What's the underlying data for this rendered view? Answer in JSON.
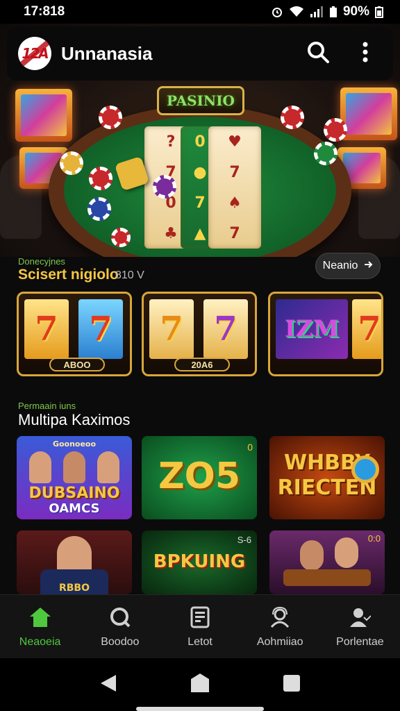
{
  "status_bar": {
    "time": "17:818",
    "battery": "90%"
  },
  "app_bar": {
    "logo_text": "12A",
    "title": "Unnanasia",
    "icons": {
      "search": "search-icon",
      "more": "more-vertical-icon"
    }
  },
  "hero": {
    "sign": "PASINIO",
    "reel_symbols": [
      [
        "?",
        "7",
        "0",
        "♣"
      ],
      [
        "0",
        "●",
        "7",
        "▲"
      ],
      [
        "♥",
        "7",
        "♠",
        "7"
      ]
    ]
  },
  "section_slots": {
    "subtitle": "Donecyjnes",
    "title": "Scisert nigiolo",
    "count": "810 V",
    "next_label": "Neanio",
    "cards": [
      {
        "symbols": [
          "7",
          "7"
        ],
        "badge": "ABOO"
      },
      {
        "symbols": [
          "7",
          "7"
        ],
        "badge": "20A6"
      },
      {
        "symbols": [
          "IZM",
          "7"
        ],
        "badge": ""
      }
    ]
  },
  "section_games": {
    "subtitle": "Permaain iuns",
    "title": "Multipa Kaximos",
    "cards": [
      {
        "line1": "DUBSAINO",
        "line2": "OAMCS",
        "top": "Goonoeoo"
      },
      {
        "line1": "ZO5",
        "line2": "",
        "top": "0"
      },
      {
        "line1": "WHBBY",
        "line2": "RIECTEN",
        "top": ""
      },
      {
        "line1": "RBBO",
        "line2": "",
        "top": ""
      },
      {
        "line1": "BPKUING",
        "line2": "",
        "top": "S-6"
      },
      {
        "line1": "",
        "line2": "",
        "top": "0:0"
      }
    ]
  },
  "bottom_nav": [
    {
      "label": "Neaoeia",
      "icon": "home-icon",
      "active": true
    },
    {
      "label": "Boodoo",
      "icon": "search-circle-icon",
      "active": false
    },
    {
      "label": "Letot",
      "icon": "receipt-icon",
      "active": false
    },
    {
      "label": "Aohmiiao",
      "icon": "support-agent-icon",
      "active": false
    },
    {
      "label": "Porlentae",
      "icon": "profile-icon",
      "active": false
    }
  ],
  "colors": {
    "accent_green": "#4fc83f",
    "gold": "#f5c842",
    "felt": "#1f8a3c"
  }
}
